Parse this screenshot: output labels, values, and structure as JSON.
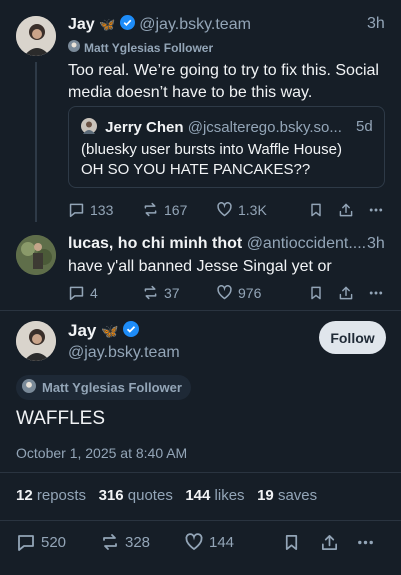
{
  "post1": {
    "author_name": "Jay",
    "author_emoji": "🦋",
    "handle": "@jay.bsky.team",
    "time": "3h",
    "follower_badge": "Matt Yglesias Follower",
    "text_line1": "Too real. We’re going to try to fix this. Social",
    "text_line2": "media doesn’t have to be this way.",
    "quote": {
      "author_name": "Jerry Chen",
      "handle": "@jcsalterego.bsky.so...",
      "time": "5d",
      "text_line1": "(bluesky user bursts into Waffle House)",
      "text_line2": "OH SO YOU HATE PANCAKES??"
    },
    "replies": "133",
    "reposts": "167",
    "likes": "1.3K"
  },
  "post2": {
    "author_name": "lucas, ho chi minh thot",
    "handle": "@antioccident....",
    "time": "3h",
    "text": "have y'all banned Jesse Singal yet or",
    "replies": "4",
    "reposts": "37",
    "likes": "976"
  },
  "main": {
    "author_name": "Jay",
    "author_emoji": "🦋",
    "handle": "@jay.bsky.team",
    "follow_label": "Follow",
    "follower_badge": "Matt Yglesias Follower",
    "text": "WAFFLES",
    "timestamp": "October 1, 2025 at 8:40 AM",
    "stats": {
      "reposts_n": "12",
      "reposts_label": "reposts",
      "quotes_n": "316",
      "quotes_label": "quotes",
      "likes_n": "144",
      "likes_label": "likes",
      "saves_n": "19",
      "saves_label": "saves"
    },
    "replies": "520",
    "reposts": "328",
    "likes": "144"
  },
  "colors": {
    "background": "#161e27",
    "verified": "#1d8cf8",
    "muted": "#93a5b7",
    "follow_bg": "#e0e6ec"
  }
}
